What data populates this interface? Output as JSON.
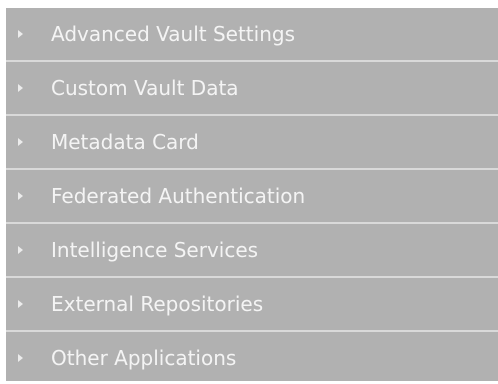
{
  "tree": {
    "items": [
      {
        "label": "Advanced Vault Settings",
        "icon": "expand-arrow-icon"
      },
      {
        "label": "Custom Vault Data",
        "icon": "expand-arrow-icon"
      },
      {
        "label": "Metadata Card",
        "icon": "expand-arrow-icon"
      },
      {
        "label": "Federated Authentication",
        "icon": "expand-arrow-icon"
      },
      {
        "label": "Intelligence Services",
        "icon": "expand-arrow-icon"
      },
      {
        "label": "External Repositories",
        "icon": "expand-arrow-icon"
      },
      {
        "label": "Other Applications",
        "icon": "expand-arrow-icon"
      }
    ]
  },
  "colors": {
    "panel_background": "#b1b1b1",
    "separator": "#d9d9d9",
    "text": "#f4f4f4"
  }
}
